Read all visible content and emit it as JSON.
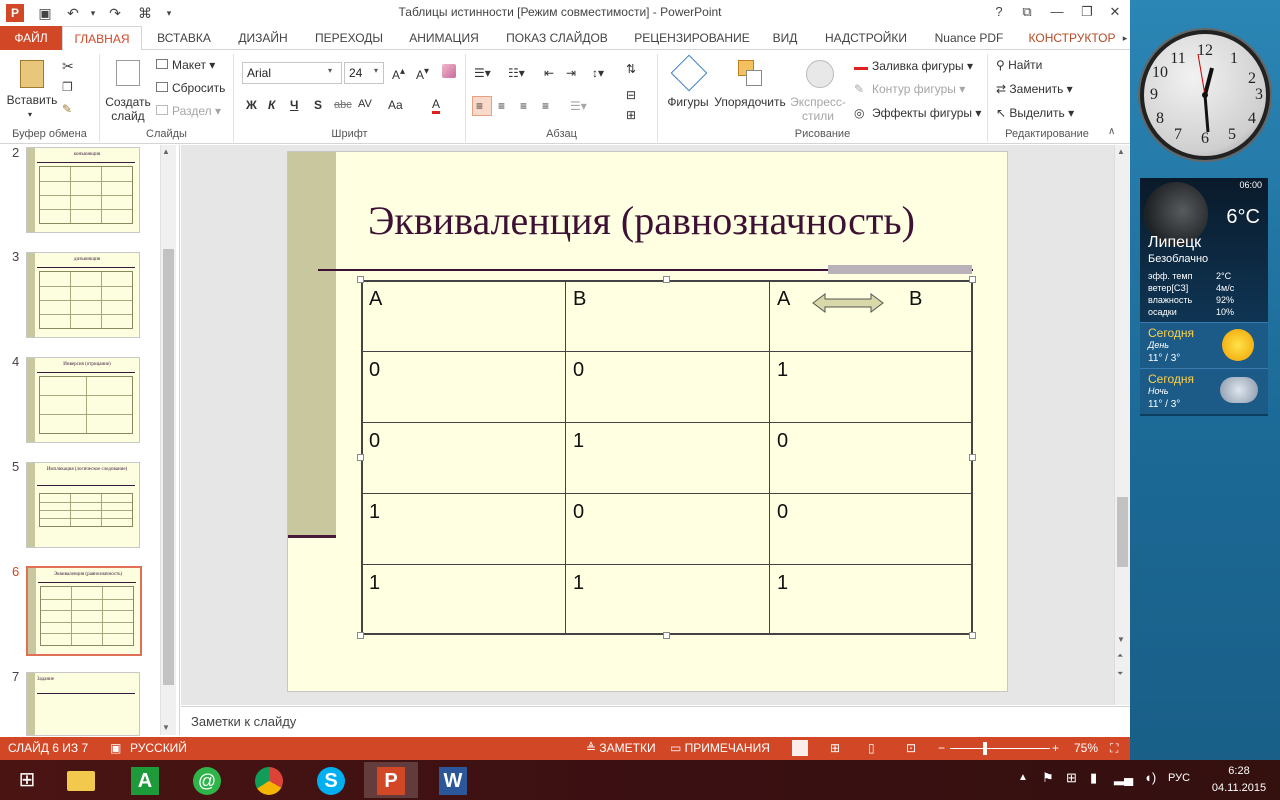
{
  "window": {
    "title": "Таблицы истинности [Режим совместимости] - PowerPoint",
    "help": "?",
    "restore_ribbon": "⧉",
    "minimize": "—",
    "maximize": "❐",
    "close": "✕"
  },
  "tabs": [
    "ФАЙЛ",
    "ГЛАВНАЯ",
    "ВСТАВКА",
    "ДИЗАЙН",
    "ПЕРЕХОДЫ",
    "АНИМАЦИЯ",
    "ПОКАЗ СЛАЙДОВ",
    "РЕЦЕНЗИРОВАНИЕ",
    "ВИД",
    "НАДСТРОЙКИ",
    "Nuance PDF",
    "КОНСТРУКТОР"
  ],
  "ribbon": {
    "clipboard": {
      "paste": "Вставить",
      "label": "Буфер обмена"
    },
    "slides": {
      "create": "Создать",
      "create2": "слайд",
      "layout": "Макет",
      "reset": "Сбросить",
      "section": "Раздел",
      "label": "Слайды"
    },
    "font": {
      "name": "Arial",
      "size": "24",
      "bold": "Ж",
      "italic": "К",
      "underline": "Ч",
      "shadow": "S",
      "strike": "abc",
      "spacing": "AV",
      "case": "Aa",
      "color": "A",
      "label": "Шрифт"
    },
    "paragraph": {
      "label": "Абзац"
    },
    "drawing": {
      "shapes": "Фигуры",
      "arrange": "Упорядочить",
      "quick": "Экспресс-",
      "quick2": "стили",
      "fill": "Заливка фигуры",
      "outline": "Контур фигуры",
      "effects": "Эффекты фигуры",
      "label": "Рисование"
    },
    "editing": {
      "find": "Найти",
      "replace": "Заменить",
      "select": "Выделить",
      "label": "Редактирование"
    }
  },
  "thumbnails": [
    {
      "num": "2",
      "title": "конъюнкция"
    },
    {
      "num": "3",
      "title": "дизъюнкция"
    },
    {
      "num": "4",
      "title": "Инверсия (отрицание)"
    },
    {
      "num": "5",
      "title": "Импликация (логическое следование)"
    },
    {
      "num": "6",
      "title": "Эквиваленция (равнозначность)"
    },
    {
      "num": "7",
      "title": "Задание"
    }
  ],
  "slide": {
    "title": "Эквиваленция (равнозначность)",
    "table": {
      "header": [
        "A",
        "B",
        "A",
        "B"
      ],
      "rows": [
        [
          "0",
          "0",
          "1"
        ],
        [
          "0",
          "1",
          "0"
        ],
        [
          "1",
          "0",
          "0"
        ],
        [
          "1",
          "1",
          "1"
        ]
      ]
    }
  },
  "notes_placeholder": "Заметки к слайду",
  "status": {
    "slide_info": "СЛАЙД 6 ИЗ 7",
    "language": "РУССКИЙ",
    "notes": "ЗАМЕТКИ",
    "comments": "ПРИМЕЧАНИЯ",
    "zoom": "75%",
    "zoom_value": 75
  },
  "taskbar": {
    "time": "6:28",
    "date": "04.11.2015",
    "lang": "РУС"
  },
  "gadget_clock": {
    "numbers": [
      "12",
      "1",
      "2",
      "3",
      "4",
      "5",
      "6",
      "7",
      "8",
      "9",
      "10",
      "11"
    ]
  },
  "weather": {
    "time": "06:00",
    "temp": "6°C",
    "city": "Липецк",
    "condition": "Безоблачно",
    "details": [
      {
        "k": "эфф. темп",
        "v": "2°C"
      },
      {
        "k": "ветер[СЗ]",
        "v": "4м/с"
      },
      {
        "k": "влажность",
        "v": "92%"
      },
      {
        "k": "осадки",
        "v": "10%"
      }
    ],
    "today_day": {
      "label": "Сегодня",
      "part": "День",
      "temps": "11° /  3°"
    },
    "today_night": {
      "label": "Сегодня",
      "part": "Ночь",
      "temps": "11° /  3°"
    }
  }
}
